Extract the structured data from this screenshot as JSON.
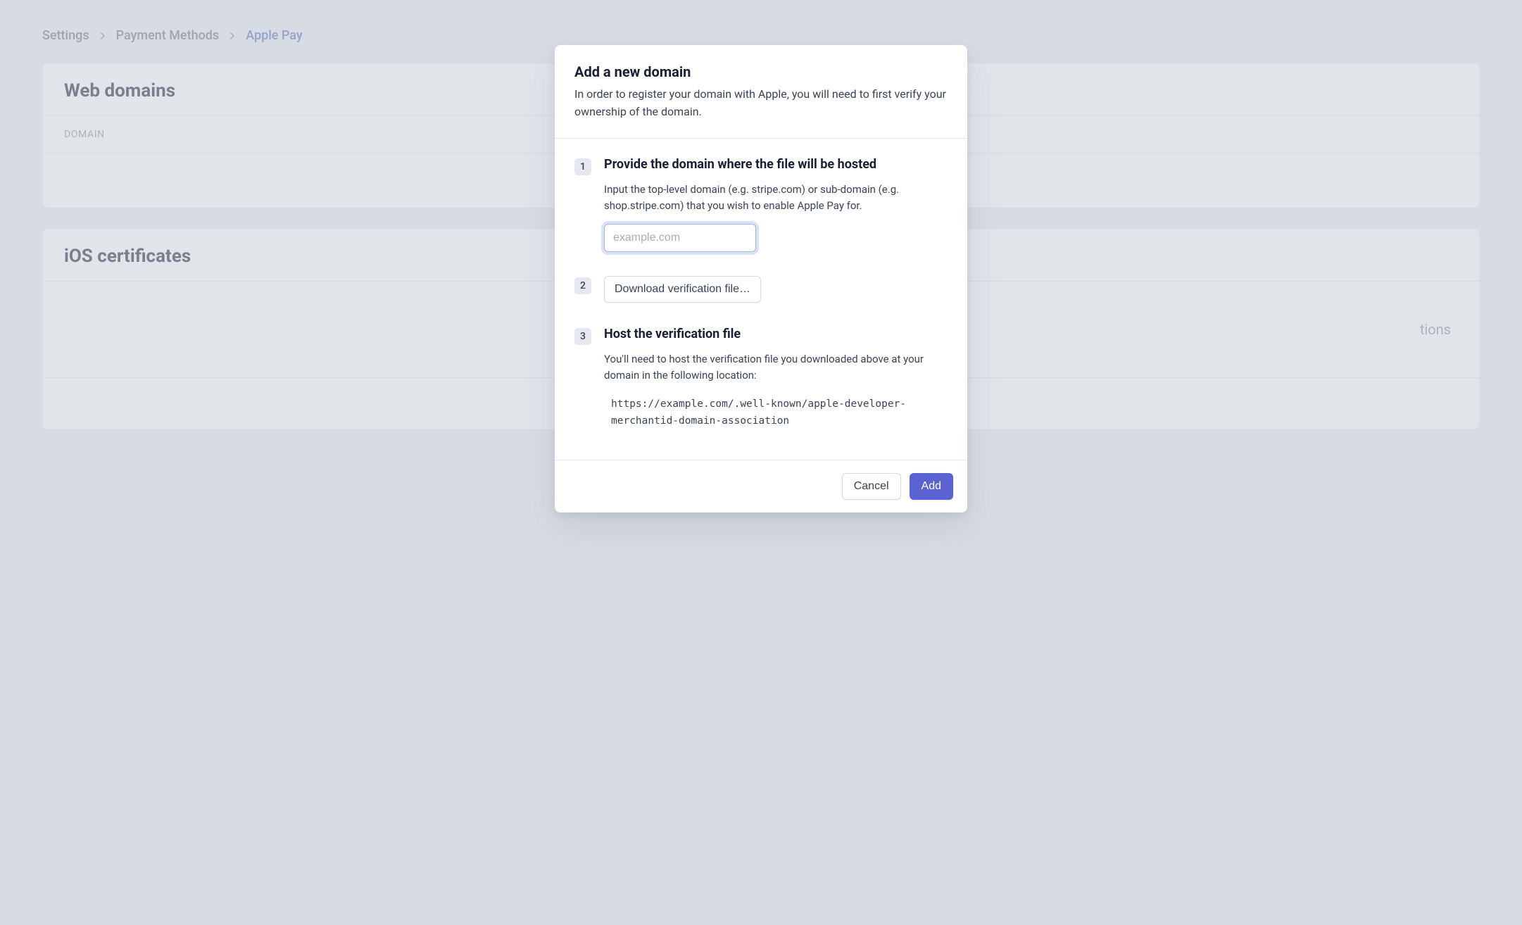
{
  "breadcrumbs": {
    "items": [
      {
        "label": "Settings"
      },
      {
        "label": "Payment Methods"
      },
      {
        "label": "Apple Pay"
      }
    ]
  },
  "web_domains": {
    "title": "Web domains",
    "column_label": "DOMAIN"
  },
  "ios_certificates": {
    "title": "iOS certificates",
    "body_fragment": "tions"
  },
  "modal": {
    "title": "Add a new domain",
    "subtitle": "In order to register your domain with Apple, you will need to first verify your ownership of the domain.",
    "steps": {
      "step1": {
        "num": "1",
        "title": "Provide the domain where the file will be hosted",
        "desc": "Input the top-level domain (e.g. stripe.com) or sub-domain (e.g. shop.stripe.com) that you wish to enable Apple Pay for.",
        "placeholder": "example.com",
        "value": ""
      },
      "step2": {
        "num": "2",
        "button": "Download verification file…"
      },
      "step3": {
        "num": "3",
        "title": "Host the verification file",
        "desc": "You'll need to host the verification file you downloaded above at your domain in the following location:",
        "path": "https://example.com/.well-known/apple-developer-merchantid-domain-association"
      }
    },
    "footer": {
      "cancel": "Cancel",
      "add": "Add"
    }
  }
}
